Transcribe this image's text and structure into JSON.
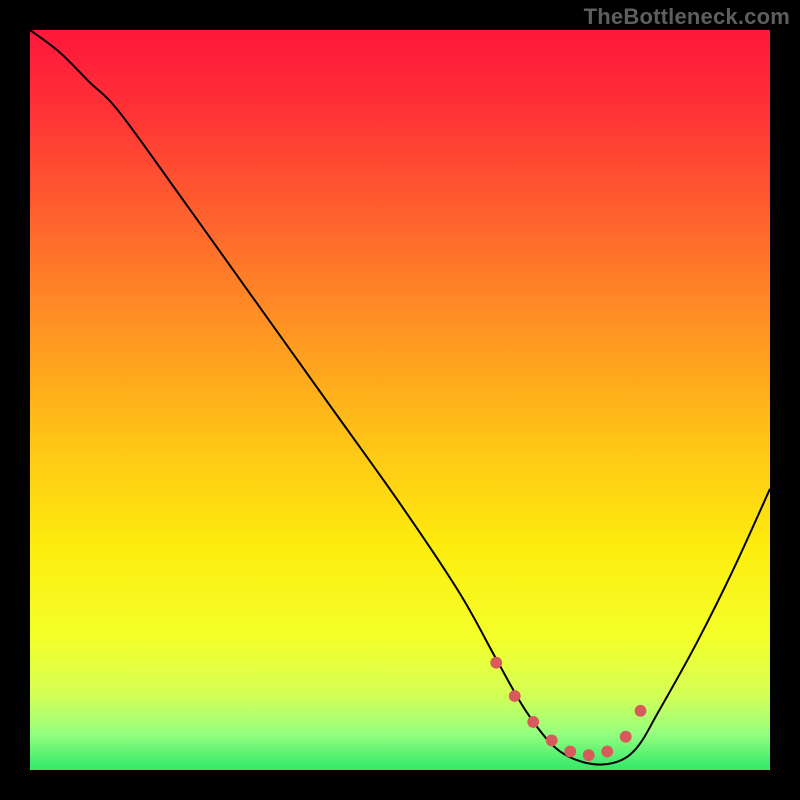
{
  "watermark": "TheBottleneck.com",
  "chart_data": {
    "type": "line",
    "title": "",
    "xlabel": "",
    "ylabel": "",
    "xlim": [
      0,
      100
    ],
    "ylim": [
      0,
      100
    ],
    "grid": false,
    "legend": false,
    "gradient_stops": [
      {
        "offset": 0.0,
        "color": "#ff173b"
      },
      {
        "offset": 0.1,
        "color": "#ff2f36"
      },
      {
        "offset": 0.25,
        "color": "#ff612e"
      },
      {
        "offset": 0.4,
        "color": "#ff9323"
      },
      {
        "offset": 0.55,
        "color": "#ffc216"
      },
      {
        "offset": 0.7,
        "color": "#fded0e"
      },
      {
        "offset": 0.82,
        "color": "#f4ff29"
      },
      {
        "offset": 0.9,
        "color": "#d3ff57"
      },
      {
        "offset": 0.95,
        "color": "#96ff7e"
      },
      {
        "offset": 1.0,
        "color": "#32e86a"
      }
    ],
    "series": [
      {
        "name": "bottleneck-curve",
        "color": "#000000",
        "x": [
          0,
          4,
          8,
          12,
          20,
          30,
          40,
          50,
          58,
          63,
          67,
          71,
          75,
          79,
          82,
          85,
          90,
          95,
          100
        ],
        "y": [
          100,
          97,
          93,
          89,
          78,
          64,
          50,
          36,
          24,
          15,
          8,
          3,
          1,
          1,
          3,
          8,
          17,
          27,
          38
        ]
      }
    ],
    "markers": {
      "name": "optimal-range",
      "color": "#d85a5a",
      "radius_frac": 0.008,
      "x": [
        63,
        65.5,
        68,
        70.5,
        73,
        75.5,
        78,
        80.5,
        82.5
      ],
      "y": [
        14.5,
        10,
        6.5,
        4,
        2.5,
        2,
        2.5,
        4.5,
        8
      ]
    }
  }
}
